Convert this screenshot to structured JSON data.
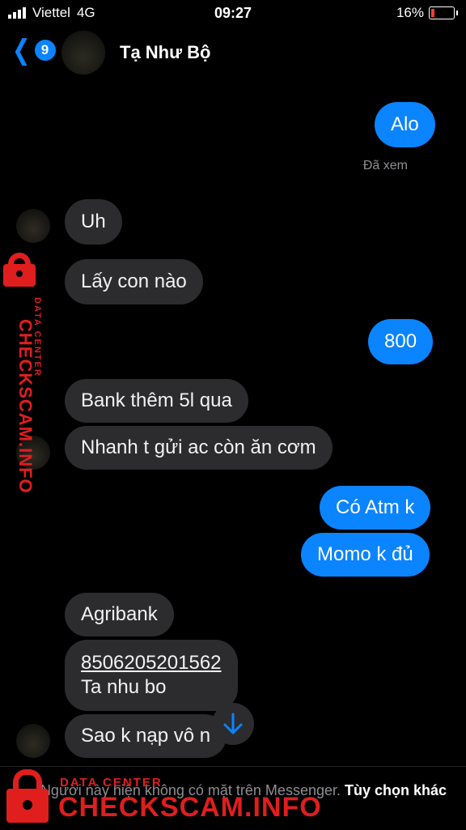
{
  "status_bar": {
    "carrier": "Viettel",
    "network": "4G",
    "time": "09:27",
    "battery_percent": "16%",
    "battery_level": 0.16
  },
  "header": {
    "back_badge": "9",
    "contact_name": "Tạ Như Bộ"
  },
  "messages": [
    {
      "dir": "out",
      "text": "Alo"
    },
    {
      "dir": "in",
      "text": "Uh"
    },
    {
      "dir": "in",
      "text": "Lấy con nào"
    },
    {
      "dir": "out",
      "text": "800"
    },
    {
      "dir": "in",
      "text": "Bank thêm 5l qua"
    },
    {
      "dir": "in",
      "text": "Nhanh t gửi ac còn ăn cơm"
    },
    {
      "dir": "out",
      "text": "Có Atm k"
    },
    {
      "dir": "out",
      "text": "Momo k đủ"
    },
    {
      "dir": "in",
      "text": "Agribank"
    },
    {
      "dir": "in",
      "text": "8506205201562",
      "text2": "Ta nhu bo"
    },
    {
      "dir": "in",
      "text": "Sao k nạp vô n"
    }
  ],
  "seen_label": "Đã xem",
  "footer": {
    "note": "Người này hiện không có mặt trên Messenger.",
    "action": "Tùy chọn khác"
  },
  "watermark": {
    "line1": "DATA CENTER",
    "line2": "CHECKSCAM.INFO"
  },
  "colors": {
    "outgoing": "#0a84ff",
    "incoming": "#2c2c2e",
    "watermark": "#e01e1e"
  }
}
